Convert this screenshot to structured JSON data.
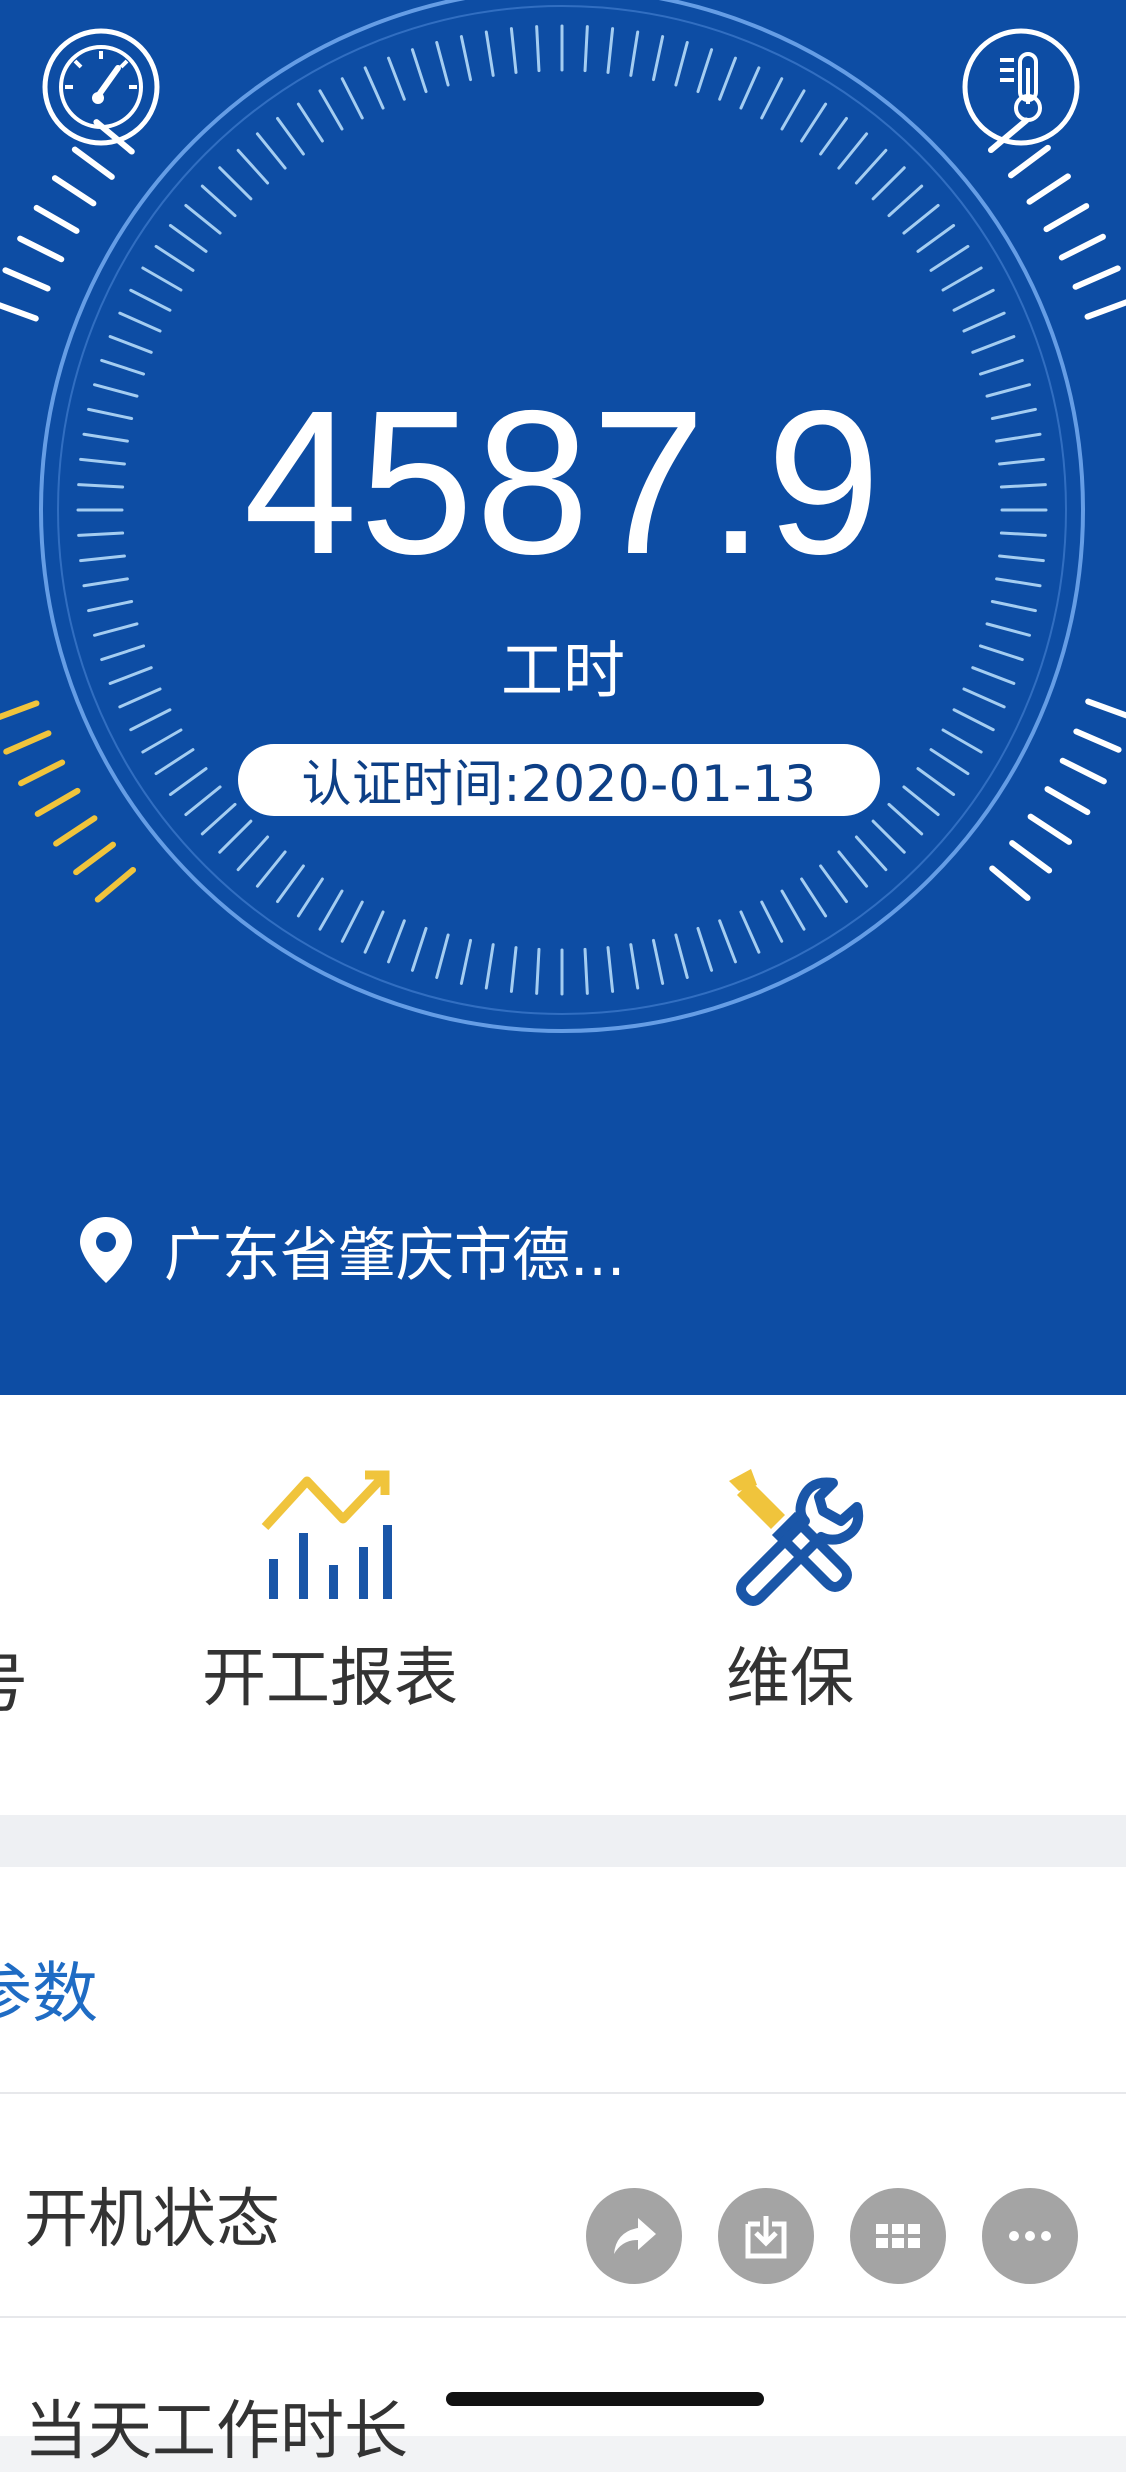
{
  "hero": {
    "value": "4587.9",
    "unit": "工时",
    "cert_time": "认证时间:2020-01-13",
    "location": "广东省肇庆市德...",
    "accent_color": "#f0c43c",
    "background_color": "#0d4da4"
  },
  "icons": {
    "left_top": "speedometer-icon",
    "right_top": "thermometer-icon",
    "location": "location-pin-icon"
  },
  "menu": {
    "cut_left_label": "号",
    "items": [
      {
        "label": "开工报表",
        "icon": "report-chart-icon"
      },
      {
        "label": "维保",
        "icon": "maintenance-tools-icon"
      }
    ]
  },
  "params": {
    "title": "参数",
    "rows": [
      {
        "label": "开机状态"
      },
      {
        "label": "当天工作时长"
      }
    ]
  },
  "floating_actions": [
    {
      "name": "share-icon"
    },
    {
      "name": "download-icon"
    },
    {
      "name": "grid-icon"
    },
    {
      "name": "more-icon"
    }
  ]
}
